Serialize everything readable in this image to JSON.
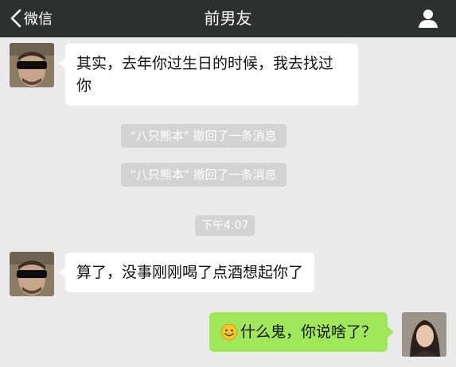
{
  "header": {
    "back_label": "微信",
    "title": "前男友"
  },
  "messages": [
    {
      "side": "left",
      "text": "其实，去年你过生日的时候，我去找过你"
    },
    {
      "side": "left",
      "text": "算了，没事刚刚喝了点酒想起你了"
    },
    {
      "side": "right",
      "text": "什么鬼，你说啥了？"
    }
  ],
  "system_notices": [
    "\"八只熊本\" 撤回了一条消息",
    "\"八只熊本\" 撤回了一条消息"
  ],
  "timestamp": "下午4:07",
  "icons": {
    "back": "chevron-left-icon",
    "contact": "user-profile-icon",
    "emoji": "smiley-emoji-icon"
  },
  "colors": {
    "topbar": "#2e3132",
    "chat_background": "#ebebeb",
    "incoming_bubble": "#ffffff",
    "outgoing_bubble": "#a0e75a",
    "system_notice": "#d3d3d3"
  }
}
